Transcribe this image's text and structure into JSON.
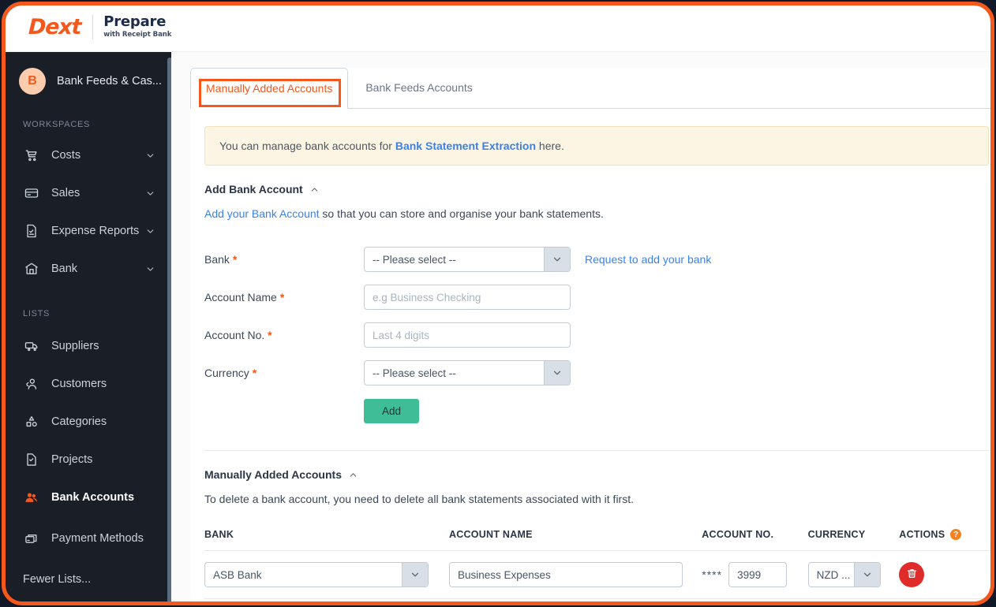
{
  "brand": {
    "logo_primary": "Dext",
    "logo_secondary": "Prepare",
    "logo_tagline": "with Receipt Bank",
    "accent_orange": "#f4581c",
    "link_blue": "#3b82e8",
    "add_button_green": "#3ebd96",
    "delete_red": "#e02b2b"
  },
  "sidebar": {
    "avatar_initial": "B",
    "workspace_name": "Bank Feeds & Cas...",
    "section_workspaces": "WORKSPACES",
    "section_lists": "LISTS",
    "workspaces": [
      {
        "label": "Costs",
        "icon": "cart-icon",
        "expandable": true
      },
      {
        "label": "Sales",
        "icon": "card-icon",
        "expandable": true
      },
      {
        "label": "Expense Reports",
        "icon": "report-icon",
        "expandable": true
      },
      {
        "label": "Bank",
        "icon": "bank-icon",
        "expandable": true
      }
    ],
    "lists": [
      {
        "label": "Suppliers",
        "icon": "truck-icon",
        "active": false
      },
      {
        "label": "Customers",
        "icon": "customers-icon",
        "active": false
      },
      {
        "label": "Categories",
        "icon": "categories-icon",
        "active": false
      },
      {
        "label": "Projects",
        "icon": "projects-icon",
        "active": false
      },
      {
        "label": "Bank Accounts",
        "icon": "bank-accounts-icon",
        "active": true
      },
      {
        "label": "Payment Methods",
        "icon": "payment-methods-icon",
        "active": false
      }
    ],
    "fewer_lists": "Fewer Lists..."
  },
  "tabs": [
    {
      "label": "Manually Added Accounts",
      "active": true
    },
    {
      "label": "Bank Feeds Accounts",
      "active": false
    }
  ],
  "notice": {
    "prefix": "You can manage bank accounts for ",
    "link": "Bank Statement Extraction",
    "suffix": " here."
  },
  "add_section": {
    "title": "Add Bank Account",
    "desc_link": "Add your Bank Account",
    "desc_rest": " so that you can store and organise your bank statements.",
    "fields": {
      "bank_label": "Bank",
      "bank_value": "-- Please select --",
      "bank_side_link": "Request to add your bank",
      "account_name_label": "Account Name",
      "account_name_placeholder": "e.g Business Checking",
      "account_name_value": "",
      "account_no_label": "Account No.",
      "account_no_placeholder": "Last 4 digits",
      "account_no_value": "",
      "currency_label": "Currency",
      "currency_value": "-- Please select --"
    },
    "add_button": "Add"
  },
  "list_section": {
    "title": "Manually Added Accounts",
    "desc": "To delete a bank account, you need to delete all bank statements associated with it first.",
    "columns": [
      "BANK",
      "ACCOUNT NAME",
      "ACCOUNT NO.",
      "CURRENCY",
      "ACTIONS"
    ],
    "actions_help": "?",
    "rows": [
      {
        "bank": "ASB Bank",
        "account_name": "Business Expenses",
        "account_no_mask": "****",
        "account_no": "3999",
        "currency": "NZD ..."
      }
    ]
  }
}
